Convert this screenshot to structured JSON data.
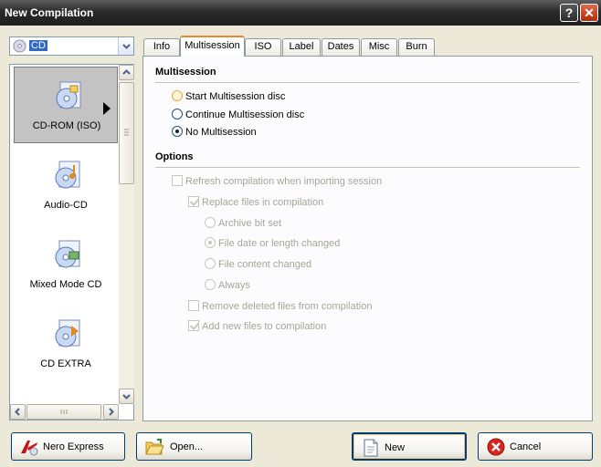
{
  "window": {
    "title": "New Compilation",
    "help_label": "?",
    "close_label": "✕"
  },
  "disc_type": {
    "selected": "CD"
  },
  "compilations": [
    {
      "label": "CD-ROM (ISO)",
      "icon": "cd-rom-iso-icon",
      "selected": true
    },
    {
      "label": "Audio-CD",
      "icon": "audio-cd-icon"
    },
    {
      "label": "Mixed Mode CD",
      "icon": "mixed-mode-cd-icon"
    },
    {
      "label": "CD EXTRA",
      "icon": "cd-extra-icon"
    }
  ],
  "tabs": [
    "Info",
    "Multisession",
    "ISO",
    "Label",
    "Dates",
    "Misc",
    "Burn"
  ],
  "active_tab": "Multisession",
  "multisession": {
    "heading": "Multisession",
    "options": [
      {
        "label": "Start Multisession disc",
        "checked": false
      },
      {
        "label": "Continue Multisession disc",
        "checked": false
      },
      {
        "label": "No Multisession",
        "checked": true
      }
    ]
  },
  "options": {
    "heading": "Options",
    "refresh": {
      "label": "Refresh compilation when importing session",
      "checked": false
    },
    "replace": {
      "label": "Replace files in compilation",
      "checked": true
    },
    "replace_modes": [
      {
        "label": "Archive bit set",
        "checked": false
      },
      {
        "label": "File date or length changed",
        "checked": true
      },
      {
        "label": "File content changed",
        "checked": false
      },
      {
        "label": "Always",
        "checked": false
      }
    ],
    "remove_deleted": {
      "label": "Remove deleted files from compilation",
      "checked": false
    },
    "add_new": {
      "label": "Add new files to compilation",
      "checked": true
    }
  },
  "buttons": {
    "nero_express": "Nero Express",
    "open": "Open...",
    "new": "New",
    "cancel": "Cancel"
  },
  "colors": {
    "title_bar": "#2a2a2a",
    "face": "#ece9d8",
    "accent_tab": "#e68b2c",
    "selection": "#316ac5"
  }
}
